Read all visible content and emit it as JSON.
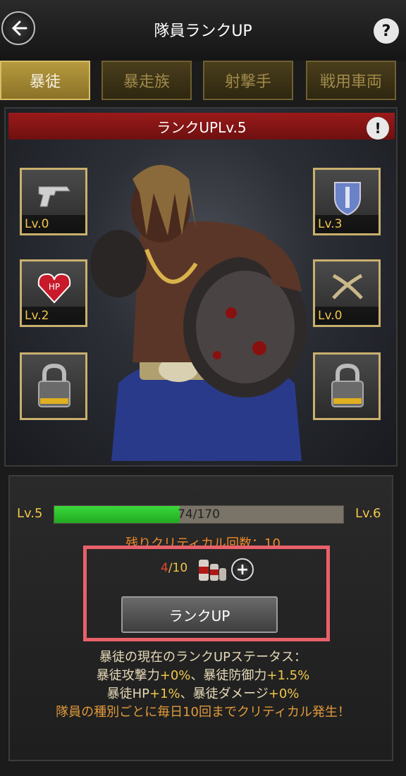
{
  "header": {
    "title": "隊員ランクUP",
    "help": "?"
  },
  "tabs": [
    {
      "label": "暴徒"
    },
    {
      "label": "暴走族"
    },
    {
      "label": "射撃手"
    },
    {
      "label": "戦用車両"
    }
  ],
  "rank_panel": {
    "banner": "ランクUPLv.5",
    "info": "!",
    "slots": [
      {
        "icon": "pistol-icon",
        "level": "Lv.0"
      },
      {
        "icon": "shield-icon",
        "level": "Lv.3"
      },
      {
        "icon": "hp-heart-icon",
        "level": "Lv.2"
      },
      {
        "icon": "kukri-knives-icon",
        "level": "Lv.0"
      },
      {
        "icon": "lock-icon",
        "level": ""
      },
      {
        "icon": "lock-icon",
        "level": ""
      }
    ]
  },
  "progress": {
    "current_level": "Lv.5",
    "next_level": "Lv.6",
    "value_text": "74/170",
    "fraction": 0.435
  },
  "critical_text": "残りクリティカル回数：10",
  "item": {
    "current": "4",
    "max": "/10",
    "plus": "+"
  },
  "rank_up_button": "ランクUP",
  "status": {
    "heading": "暴徒の現在のランクUPステータス：",
    "line1_a": "暴徒攻撃力",
    "line1_b": "+0%",
    "line1_c": "、暴徒防御力",
    "line1_d": "+1.5%",
    "line2_a": "暴徒HP",
    "line2_b": "+1%",
    "line2_c": "、暴徒ダメージ",
    "line2_d": "+0%",
    "line3": "隊員の種別ごとに毎日10回までクリティカル発生！"
  },
  "colors": {
    "accent_gold": "#f0c64a",
    "banner_red": "#9a1a1a",
    "progress_green": "#2fc12f",
    "highlight": "#e8616a"
  }
}
